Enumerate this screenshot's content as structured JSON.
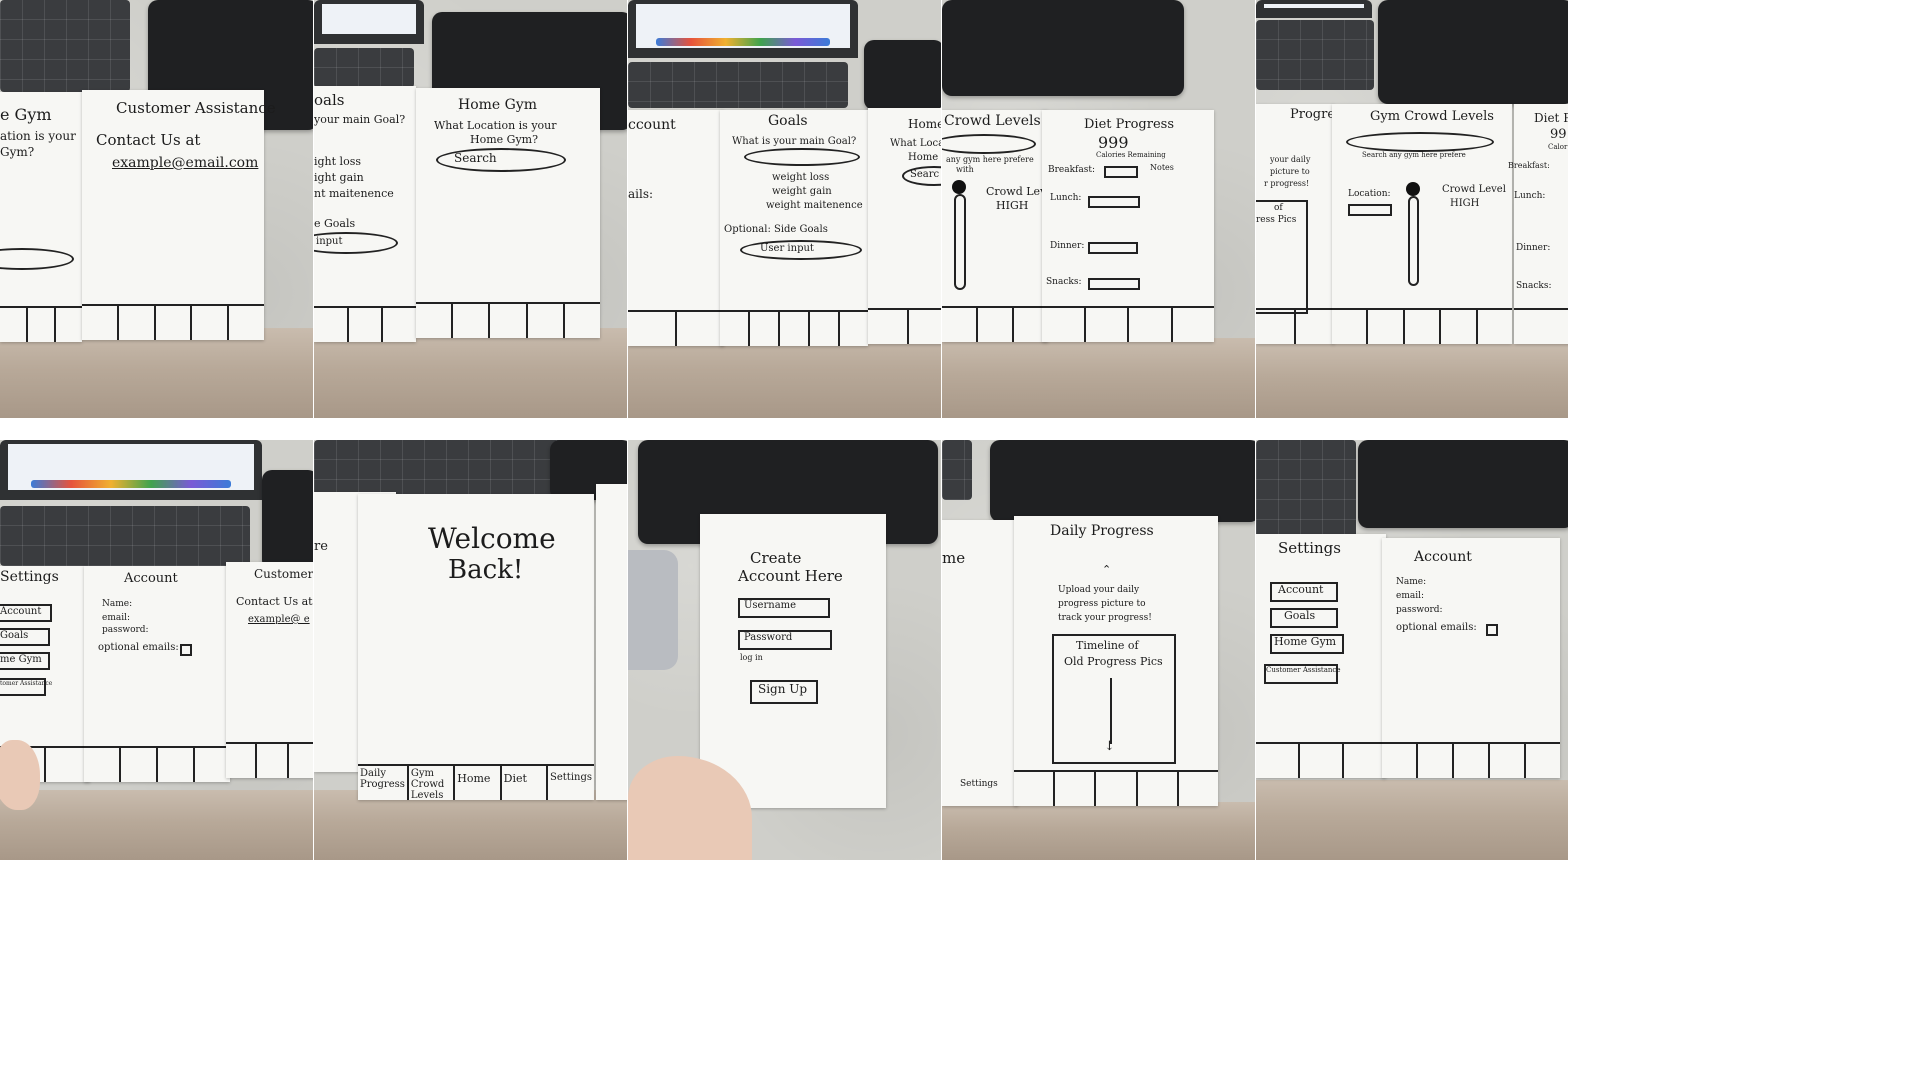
{
  "panels": {
    "p1": {
      "left_title": "e Gym",
      "left_question": "ation is your",
      "left_question2": "Gym?",
      "title": "Customer Assistance",
      "contact": "Contact Us at",
      "email": "example@email.com"
    },
    "p2": {
      "left_title": "oals",
      "left_question": "your main Goal?",
      "opt1": "ight loss",
      "opt2": "ight gain",
      "opt3": "nt maitenence",
      "side": "e Goals",
      "input": "input",
      "title": "Home Gym",
      "question": "What Location is your",
      "question2": "Home Gym?",
      "search": "Search"
    },
    "p3": {
      "left_title": "ccount",
      "emails": "ails:",
      "title": "Goals",
      "question": "What is your main Goal?",
      "opt1": "weight loss",
      "opt2": "weight gain",
      "opt3": "weight maitenence",
      "optional": "Optional: Side Goals",
      "input": "User input",
      "right_title": "Home",
      "right_q": "What Locat",
      "right_q2": "Home",
      "right_search": "Searc"
    },
    "p4": {
      "left_title": "Crowd Levels",
      "left_sub": "any gym here prefere",
      "left_sub2": "with",
      "crowd": "Crowd Level",
      "crowd_val": "HIGH",
      "title": "Diet Progress",
      "calories": "999",
      "calories_label": "Calories Remaining",
      "notes": "Notes",
      "breakfast": "Breakfast:",
      "lunch": "Lunch:",
      "dinner": "Dinner:",
      "snacks": "Snacks:"
    },
    "p5": {
      "left_title": "Progress",
      "left_up1": "your daily",
      "left_up2": "picture to",
      "left_up3": "r progress!",
      "left_tl1": "of",
      "left_tl2": "ress Pics",
      "title": "Gym Crowd Levels",
      "sub": "Search any gym here prefere",
      "location": "Location:",
      "crowd": "Crowd Level",
      "crowd_val": "HIGH",
      "right_title": "Diet Pr",
      "right_cal": "99",
      "right_cal_label": "Calor",
      "breakfast": "Breakfast:",
      "lunch": "Lunch:",
      "dinner": "Dinner:",
      "snacks": "Snacks:"
    },
    "p6": {
      "settings": "Settings",
      "btn1": "Account",
      "btn2": "Goals",
      "btn3": "me Gym",
      "btn4": "tomer Assistance",
      "title": "Account",
      "name": "Name:",
      "email": "email:",
      "password": "password:",
      "optional": "optional emails:",
      "right_title": "Customer A",
      "right_contact": "Contact Us at",
      "right_email": "example@ e"
    },
    "p7": {
      "left_frag": "re",
      "title1": "Welcome",
      "title2": "Back!",
      "tabs": [
        "Daily Progress",
        "Gym Crowd Levels",
        "Home",
        "Diet",
        "Settings"
      ]
    },
    "p8": {
      "title1": "Create",
      "title2": "Account Here",
      "username": "Username",
      "password": "Password",
      "login": "log in",
      "signup": "Sign Up"
    },
    "p9": {
      "left_frag": "me",
      "left_tab": "Settings",
      "title": "Daily Progress",
      "upload1": "Upload your daily",
      "upload2": "progress picture to",
      "upload3": "track your progress!",
      "timeline1": "Timeline of",
      "timeline2": "Old Progress Pics"
    },
    "p10": {
      "settings": "Settings",
      "btn1": "Account",
      "btn2": "Goals",
      "btn3": "Home Gym",
      "btn4": "Customer Assistance",
      "title": "Account",
      "name": "Name:",
      "email": "email:",
      "password": "password:",
      "optional": "optional emails:"
    }
  }
}
